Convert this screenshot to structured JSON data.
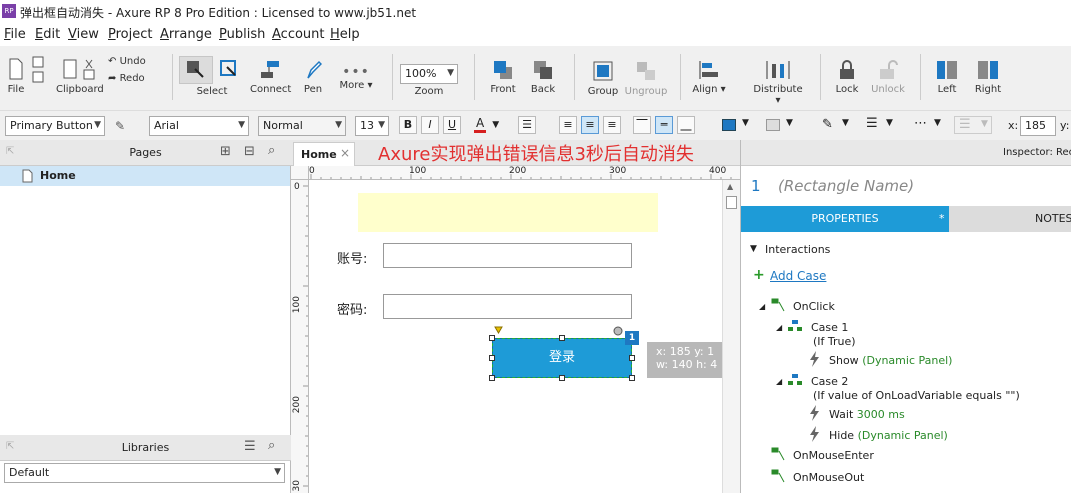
{
  "window": {
    "title": "弹出框自动消失 - Axure RP 8 Pro Edition : Licensed to www.jb51.net",
    "app_icon": "RP"
  },
  "menu": [
    {
      "key": "F",
      "rest": "ile"
    },
    {
      "key": "E",
      "rest": "dit"
    },
    {
      "key": "V",
      "rest": "iew"
    },
    {
      "key": "P",
      "rest": "roject"
    },
    {
      "key": "A",
      "rest": "rrange"
    },
    {
      "key": "P",
      "rest": "ublish"
    },
    {
      "key": "A",
      "rest": "ccount"
    },
    {
      "key": "H",
      "rest": "elp"
    }
  ],
  "toolbar": {
    "file": "File",
    "clipboard": "Clipboard",
    "undo": "Undo",
    "redo": "Redo",
    "select": "Select",
    "connect": "Connect",
    "pen": "Pen",
    "more": "More ▾",
    "zoom_value": "100%",
    "zoom": "Zoom",
    "front": "Front",
    "back": "Back",
    "group": "Group",
    "ungroup": "Ungroup",
    "align": "Align ▾",
    "distribute": "Distribute ▾",
    "lock": "Lock",
    "unlock": "Unlock",
    "left": "Left",
    "right": "Right"
  },
  "format": {
    "style": "Primary Button",
    "font": "Arial",
    "weight": "Normal",
    "size": "13",
    "bold": "B",
    "italic": "I",
    "underline": "U",
    "font_color_letter": "A",
    "x_label": "x:",
    "x_value": "185",
    "y_label": "y:"
  },
  "pages": {
    "header": "Pages",
    "items": [
      "Home"
    ]
  },
  "libraries": {
    "header": "Libraries",
    "selected": "Default"
  },
  "canvas": {
    "tab": "Home",
    "tab_close": "×",
    "annotation": "Axure实现弹出错误信息3秒后自动消失",
    "ruler_h": [
      "0",
      "100",
      "200",
      "300",
      "400"
    ],
    "ruler_v": [
      "0",
      "100",
      "200",
      "30"
    ],
    "account_label": "账号:",
    "password_label": "密码:",
    "login_button": "登录",
    "badge": "1",
    "tooltip": {
      "line1": "x: 185    y: 1",
      "line2": "w: 140    h: 4"
    },
    "accent": "#1e9bd7"
  },
  "inspector": {
    "header": "Inspector: Rec",
    "index": "1",
    "name_placeholder": "(Rectangle Name)",
    "tab_properties": "PROPERTIES",
    "tab_star": "*",
    "tab_notes": "NOTES",
    "interactions": "Interactions",
    "add_case": "Add Case",
    "events": {
      "onclick": "OnClick",
      "case1": "Case 1",
      "case1_cond": "(If True)",
      "show": "Show",
      "show_target": "(Dynamic Panel)",
      "case2": "Case 2",
      "case2_cond": "(If value of OnLoadVariable equals \"\")",
      "wait": "Wait",
      "wait_value": "3000 ms",
      "hide": "Hide",
      "hide_target": "(Dynamic Panel)",
      "onmouseenter": "OnMouseEnter",
      "onmouseout": "OnMouseOut"
    }
  }
}
